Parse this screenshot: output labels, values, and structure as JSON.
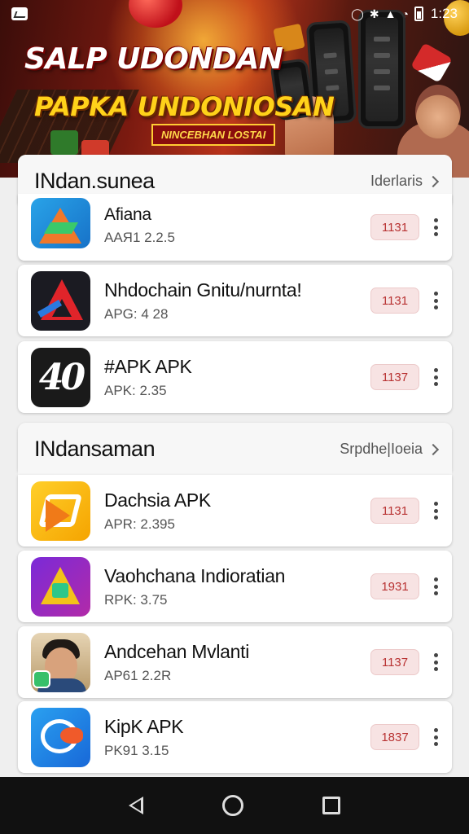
{
  "status_bar": {
    "time": "1:23",
    "icons": [
      "notification-icon",
      "alarm-icon",
      "bluetooth-icon",
      "signal-icon",
      "wifi-icon",
      "battery-icon"
    ]
  },
  "banner": {
    "headline_line1": "SALP UDONDAN",
    "headline_line2": "PAPKA UNDONIOSAN",
    "subtitle": "NINCEBHAN LOSTAI"
  },
  "sections": [
    {
      "title": "INdan.sunea",
      "link_label": "Iderlaris",
      "items": [
        {
          "icon": "blue-arrow-app-icon",
          "name": "Afiana",
          "meta": "AAЯ1 2.2.5",
          "badge": "1131"
        },
        {
          "icon": "black-a-app-icon",
          "name": "Nhdochain Gnitu/nurnta!",
          "meta": "APG: 4 28",
          "badge": "1131"
        },
        {
          "icon": "black-40-app-icon",
          "name": "#APK APK",
          "meta": "APK: 2.35",
          "badge": "1137"
        }
      ]
    },
    {
      "title": "INdansaman",
      "link_label": "Srpdhe|Ioeia",
      "items": [
        {
          "icon": "yellow-app-icon",
          "name": "Dachsia APK",
          "meta": "APR: 2.395",
          "badge": "1131"
        },
        {
          "icon": "purple-app-icon",
          "name": "Vaohchana Indioratian",
          "meta": "RPK: 3.75",
          "badge": "1931"
        },
        {
          "icon": "face-app-icon",
          "name": "Andcehan Mvlanti",
          "meta": "AP61 2.2R",
          "badge": "1137"
        },
        {
          "icon": "blue-bubble-app-icon",
          "name": "KipK APK",
          "meta": "PK91 3.15",
          "badge": "1837"
        }
      ]
    }
  ],
  "icon_art": {
    "icon_40_glyph": "40"
  },
  "colors": {
    "badge_bg": "#f7e3e3",
    "badge_text": "#b83232",
    "nav_bg": "#111111",
    "page_bg": "#efefef"
  }
}
